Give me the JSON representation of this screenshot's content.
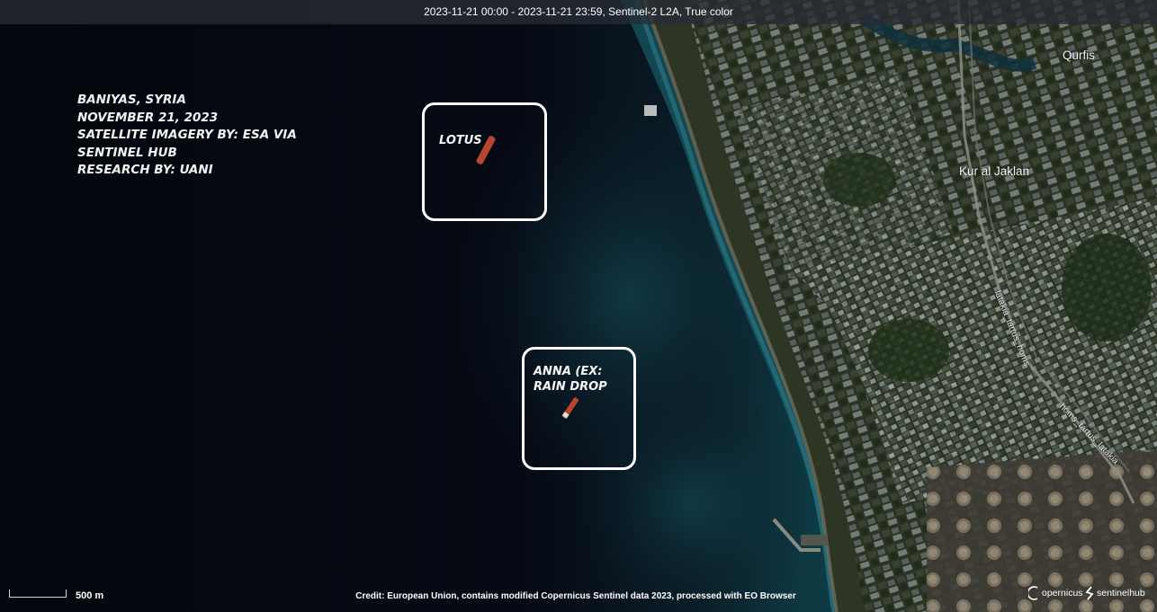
{
  "header": {
    "title": "2023-11-21 00:00 - 2023-11-21 23:59, Sentinel-2 L2A, True color"
  },
  "caption": {
    "lines": [
      "BANIYAS, SYRIA",
      "NOVEMBER 21, 2023",
      "SATELLITE IMAGERY BY: ESA VIA",
      "SENTINEL HUB",
      "RESEARCH BY: UANI"
    ]
  },
  "vessels": [
    {
      "label": "LOTUS"
    },
    {
      "label": "ANNA (EX: RAIN DROP"
    }
  ],
  "places": {
    "qurfis": "Qurfis",
    "kur_al_jaklan": "Kur al Jaklan"
  },
  "roads": {
    "road1": "latakia_tartus_homs",
    "road2": "homs_tartus_latakia"
  },
  "footer": {
    "scale": "500 m",
    "credit": "Credit: European Union, contains modified Copernicus Sentinel data 2023, processed with EO Browser",
    "logo_copernicus": "opernicus",
    "logo_sentinelhub": "sentinelhub"
  },
  "colors": {
    "sea_deep": "#05070f",
    "coastal_water": "#0d3a43",
    "land": "#2c3424",
    "highlight": "#ffffff",
    "vessel": "#b8452e"
  }
}
